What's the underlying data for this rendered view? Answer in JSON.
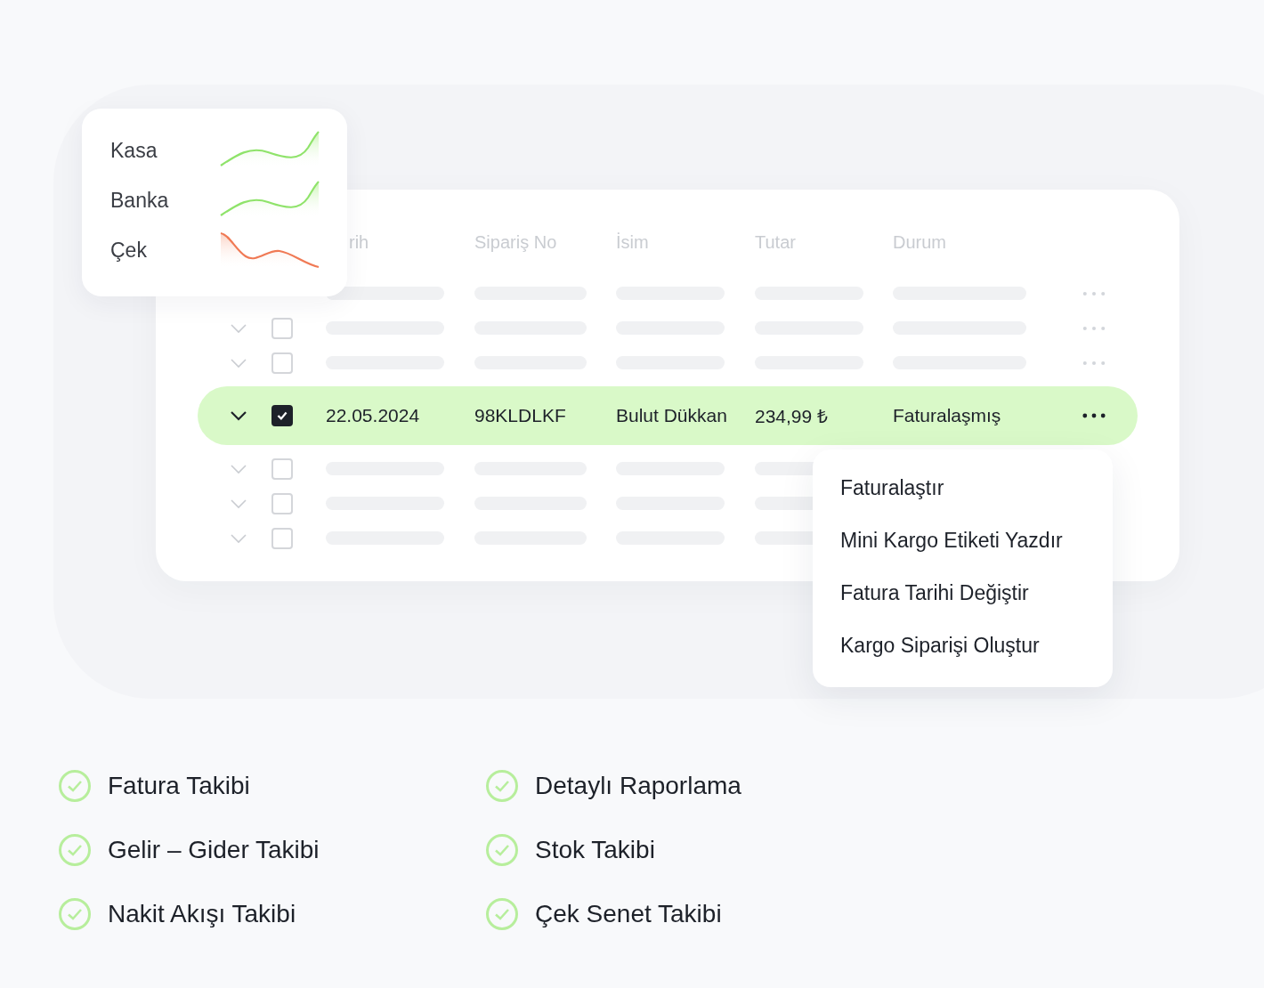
{
  "accounts": [
    {
      "label": "Kasa",
      "kind": "rising"
    },
    {
      "label": "Banka",
      "kind": "rising"
    },
    {
      "label": "Çek",
      "kind": "falling"
    }
  ],
  "table": {
    "columns": [
      "rih",
      "Sipariş No",
      "İsim",
      "Tutar",
      "Durum"
    ],
    "rows": [
      {
        "kind": "skeleton"
      },
      {
        "kind": "skeleton",
        "checked": false
      },
      {
        "kind": "skeleton",
        "checked": false
      },
      {
        "kind": "data",
        "selected": true,
        "checked": true,
        "cells": [
          "22.05.2024",
          "98KLDLKF",
          "Bulut Dükkan",
          "234,99 ₺",
          "Faturalaşmış"
        ]
      },
      {
        "kind": "skeleton-covered",
        "checked": false
      },
      {
        "kind": "skeleton-covered",
        "checked": false
      },
      {
        "kind": "skeleton-covered",
        "checked": false
      }
    ]
  },
  "context_menu": [
    "Faturalaştır",
    "Mini Kargo Etiketi Yazdır",
    "Fatura Tarihi Değiştir",
    "Kargo Siparişi Oluştur"
  ],
  "features": [
    "Fatura Takibi",
    "Detaylı Raporlama",
    "Gelir – Gider Takibi",
    "Stok Takibi",
    "Nakit Akışı Takibi",
    "Çek Senet Takibi"
  ]
}
